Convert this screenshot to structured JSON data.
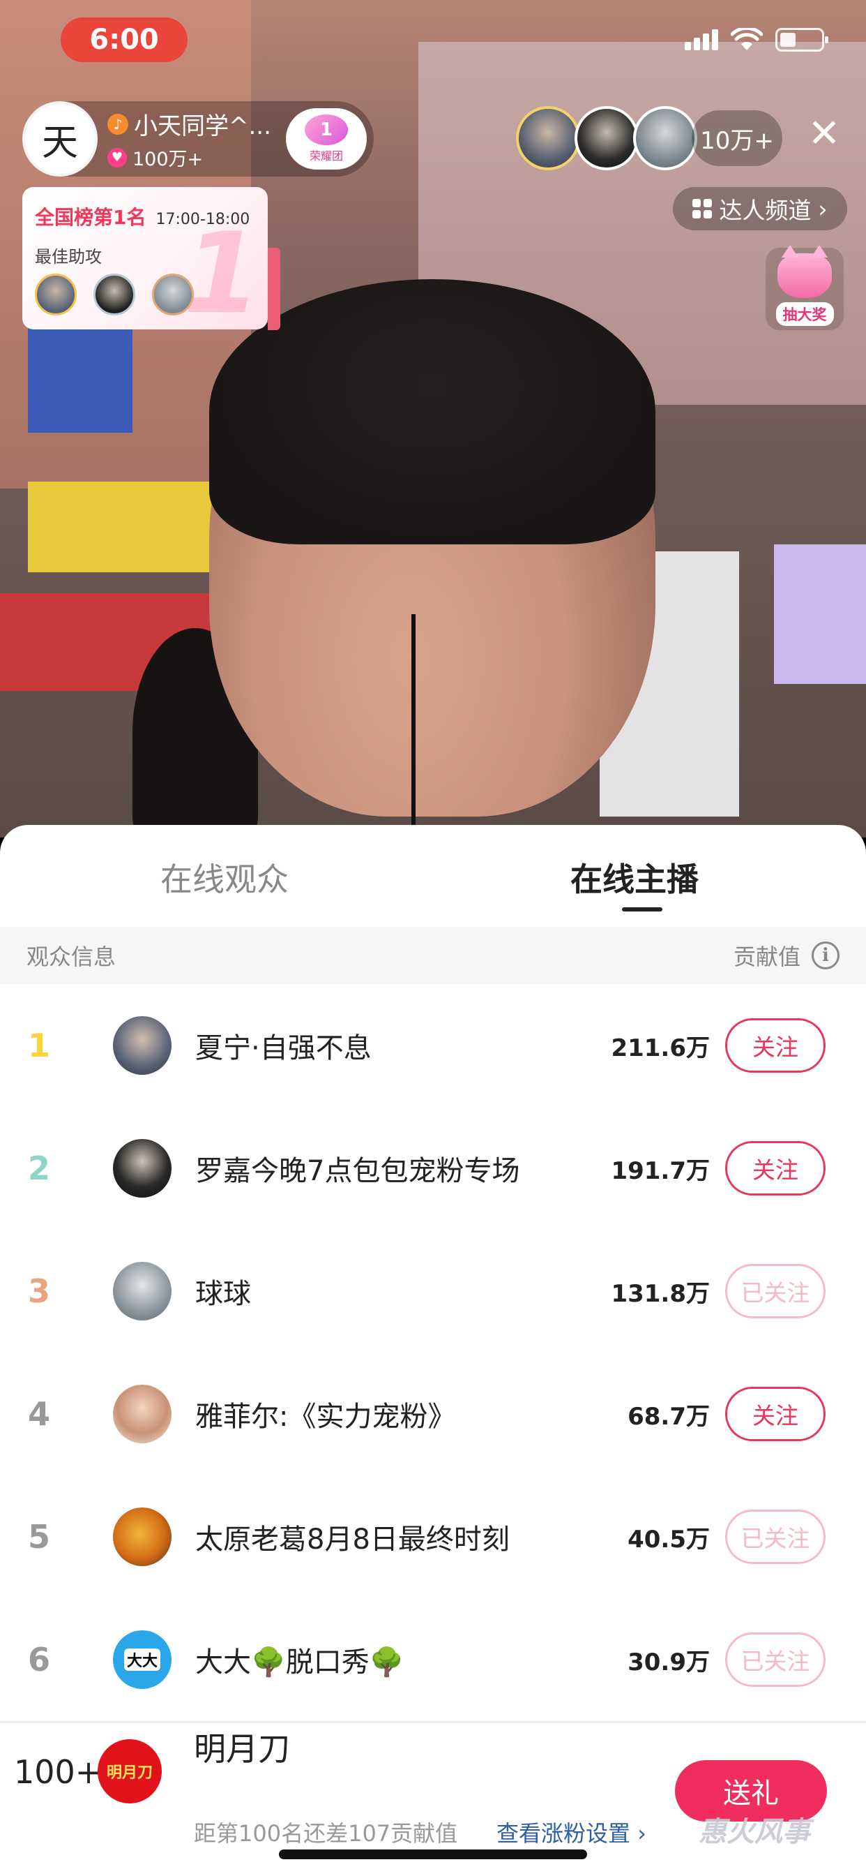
{
  "status_bar": {
    "time": "6:00"
  },
  "host": {
    "avatar_char": "天",
    "name": "小天同学^...",
    "likes": "100万+",
    "fan_badge_level": "1",
    "fan_badge_text": "荣耀团"
  },
  "viewers": {
    "count": "10万+"
  },
  "channel_button": "达人频道",
  "lottery_label": "抽大奖",
  "rank_card": {
    "title": "全国榜第1名",
    "time_range": "17:00-18:00",
    "best_assist_label": "最佳助攻",
    "big_number": "1"
  },
  "tabs": [
    {
      "label": "在线观众",
      "active": false
    },
    {
      "label": "在线主播",
      "active": true
    }
  ],
  "table_header": {
    "left": "观众信息",
    "right": "贡献值"
  },
  "ranking": [
    {
      "rank": "1",
      "rank_color": "#f5d63c",
      "name": "夏宁·自强不息",
      "score": "211.6万",
      "follow": "关注",
      "followed": false
    },
    {
      "rank": "2",
      "rank_color": "#8fd3c9",
      "name": "罗嘉今晚7点包包宠粉专场",
      "score": "191.7万",
      "follow": "关注",
      "followed": false
    },
    {
      "rank": "3",
      "rank_color": "#e9a57f",
      "name": "球球",
      "score": "131.8万",
      "follow": "已关注",
      "followed": true
    },
    {
      "rank": "4",
      "rank_color": "#999999",
      "name": "雅菲尔:《实力宠粉》",
      "score": "68.7万",
      "follow": "关注",
      "followed": false
    },
    {
      "rank": "5",
      "rank_color": "#999999",
      "name": "太原老葛8月8日最终时刻",
      "score": "40.5万",
      "follow": "已关注",
      "followed": true
    },
    {
      "rank": "6",
      "rank_color": "#999999",
      "name": "大大🌳脱口秀🌳",
      "score": "30.9万",
      "follow": "已关注",
      "followed": true
    }
  ],
  "avatar6_text": "大大",
  "me": {
    "rank": "100+",
    "avatar_text": "明月刀",
    "name": "明月刀",
    "gap_text": "距第100名还差107贡献值",
    "settings_link": "查看涨粉设置 ›"
  },
  "gift_button": "送礼",
  "watermark": "惠火风事",
  "colors": {
    "accent": "#e8365d",
    "gift": "#f02e5d"
  }
}
